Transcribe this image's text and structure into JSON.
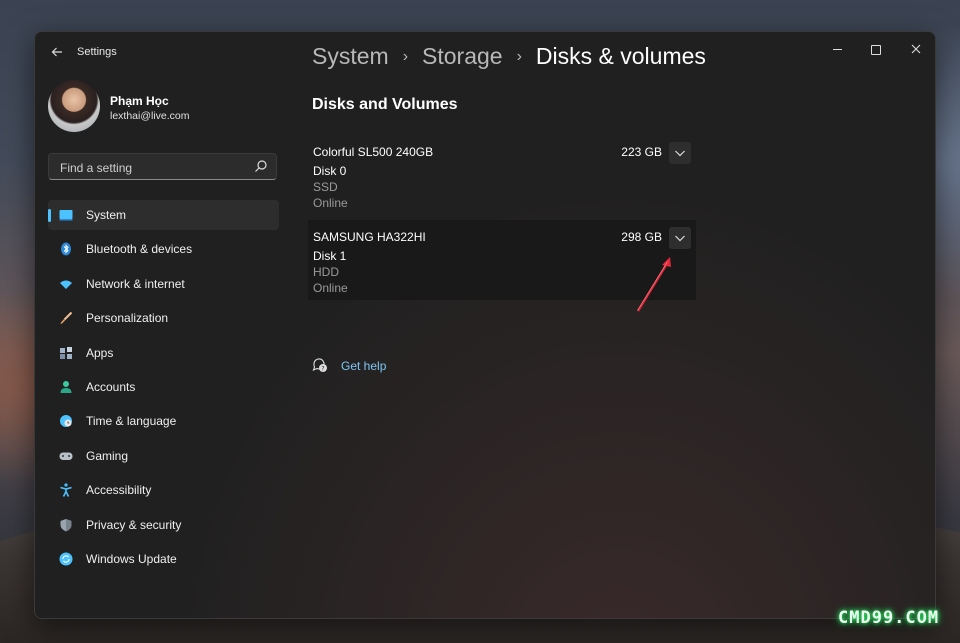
{
  "app": {
    "title": "Settings"
  },
  "window_controls": {
    "minimize": "minimize",
    "maximize": "maximize",
    "close": "close"
  },
  "user": {
    "name": "Phạm Học",
    "email": "lexthai@live.com"
  },
  "search": {
    "placeholder": "Find a setting"
  },
  "nav": {
    "items": [
      {
        "label": "System",
        "icon": "system-icon",
        "active": true,
        "color": "#4cc2ff"
      },
      {
        "label": "Bluetooth & devices",
        "icon": "bluetooth-icon",
        "color": "#2b88d8"
      },
      {
        "label": "Network & internet",
        "icon": "wifi-icon",
        "color": "#4cc2ff"
      },
      {
        "label": "Personalization",
        "icon": "brush-icon",
        "color": "#e8a060"
      },
      {
        "label": "Apps",
        "icon": "apps-icon",
        "color": "#9fb2c8"
      },
      {
        "label": "Accounts",
        "icon": "person-icon",
        "color": "#3cc8a0"
      },
      {
        "label": "Time & language",
        "icon": "globe-clock-icon",
        "color": "#4cc2ff"
      },
      {
        "label": "Gaming",
        "icon": "gamepad-icon",
        "color": "#b8c0c8"
      },
      {
        "label": "Accessibility",
        "icon": "accessibility-icon",
        "color": "#4cc2ff"
      },
      {
        "label": "Privacy & security",
        "icon": "shield-icon",
        "color": "#9aa4ae"
      },
      {
        "label": "Windows Update",
        "icon": "update-icon",
        "color": "#4cc2ff"
      }
    ]
  },
  "breadcrumb": {
    "part1": "System",
    "part2": "Storage",
    "current": "Disks & volumes",
    "separator": "›"
  },
  "section": {
    "title": "Disks and Volumes"
  },
  "disks": [
    {
      "name": "Colorful SL500 240GB",
      "size": "223 GB",
      "disk": "Disk 0",
      "type": "SSD",
      "status": "Online"
    },
    {
      "name": "SAMSUNG HA322HI",
      "size": "298 GB",
      "disk": "Disk 1",
      "type": "HDD",
      "status": "Online"
    }
  ],
  "help": {
    "label": "Get help"
  },
  "watermark": {
    "text": "CMD99.COM"
  },
  "colors": {
    "accent": "#4cc2ff",
    "link": "#7fc7f5",
    "annotation_arrow": "#e8283a"
  }
}
